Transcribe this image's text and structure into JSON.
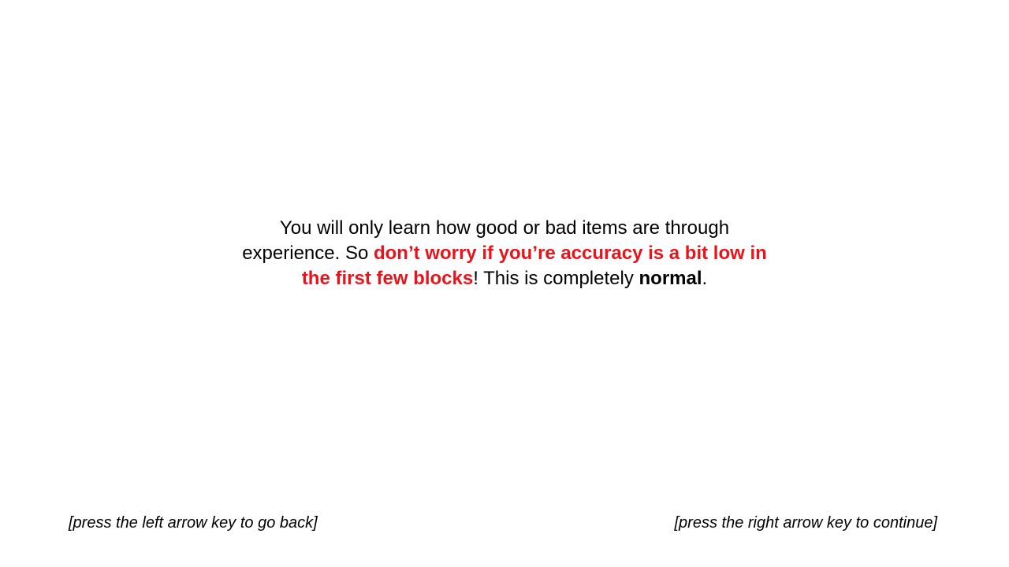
{
  "instruction": {
    "part1": "You will only learn how good or bad items are through experience. So ",
    "warning": "don’t worry if you’re accuracy is a bit low in the first few blocks",
    "part2": "! This is completely ",
    "emphasis": "normal",
    "part3": "."
  },
  "navigation": {
    "back_hint": "[press the left arrow key to go back]",
    "continue_hint": "[press the right arrow key to continue]"
  },
  "colors": {
    "background": "#ffffff",
    "text": "#000000",
    "warning": "#e8141b"
  }
}
